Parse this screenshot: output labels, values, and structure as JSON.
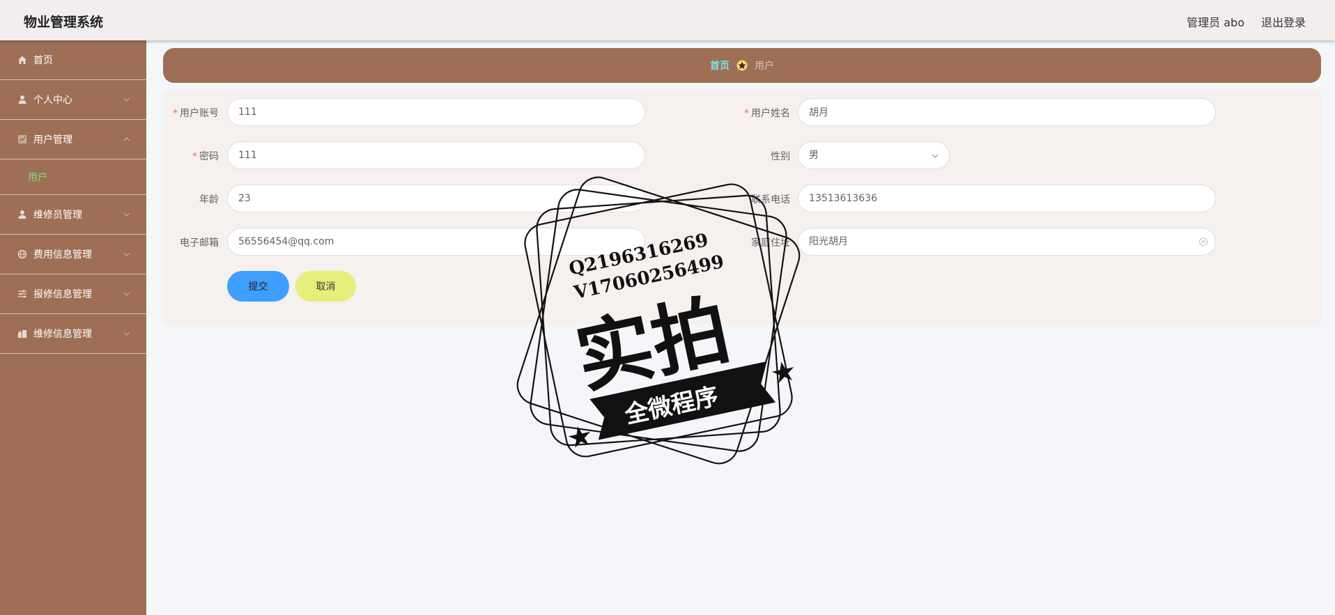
{
  "app": {
    "title": "物业管理系统"
  },
  "header": {
    "user_label": "管理员 abo",
    "logout_label": "退出登录"
  },
  "sidebar": {
    "items": [
      {
        "label": "首页",
        "icon": "home-icon"
      },
      {
        "label": "个人中心",
        "icon": "user-icon"
      },
      {
        "label": "用户管理",
        "icon": "chart-icon",
        "expanded": true,
        "children": [
          {
            "label": "用户"
          }
        ]
      },
      {
        "label": "维修员管理",
        "icon": "user-icon"
      },
      {
        "label": "费用信息管理",
        "icon": "globe-icon"
      },
      {
        "label": "报修信息管理",
        "icon": "sliders-icon"
      },
      {
        "label": "维修信息管理",
        "icon": "building-icon"
      }
    ]
  },
  "breadcrumb": {
    "home": "首页",
    "current": "用户"
  },
  "form": {
    "account": {
      "label": "用户账号",
      "value": "111",
      "required": true
    },
    "name": {
      "label": "用户姓名",
      "value": "胡月",
      "required": true
    },
    "password": {
      "label": "密码",
      "value": "111",
      "required": true
    },
    "gender": {
      "label": "性别",
      "value": "男"
    },
    "age": {
      "label": "年龄",
      "value": "23"
    },
    "phone": {
      "label": "联系电话",
      "value": "13513613636"
    },
    "email": {
      "label": "电子邮箱",
      "value": "56556454@qq.com"
    },
    "address": {
      "label": "家庭住址",
      "value": "阳光胡月"
    },
    "submit_label": "提交",
    "cancel_label": "取消"
  },
  "watermark": {
    "line1": "Q2196316269",
    "line2": "V17060256499",
    "main": "实拍",
    "ribbon": "全微程序"
  },
  "colors": {
    "brand": "#9e6f55",
    "submit": "#409eff",
    "cancel": "#e6ef7b",
    "active_submenu": "#7fe07a",
    "breadcrumb_home": "#7ee0f0"
  }
}
